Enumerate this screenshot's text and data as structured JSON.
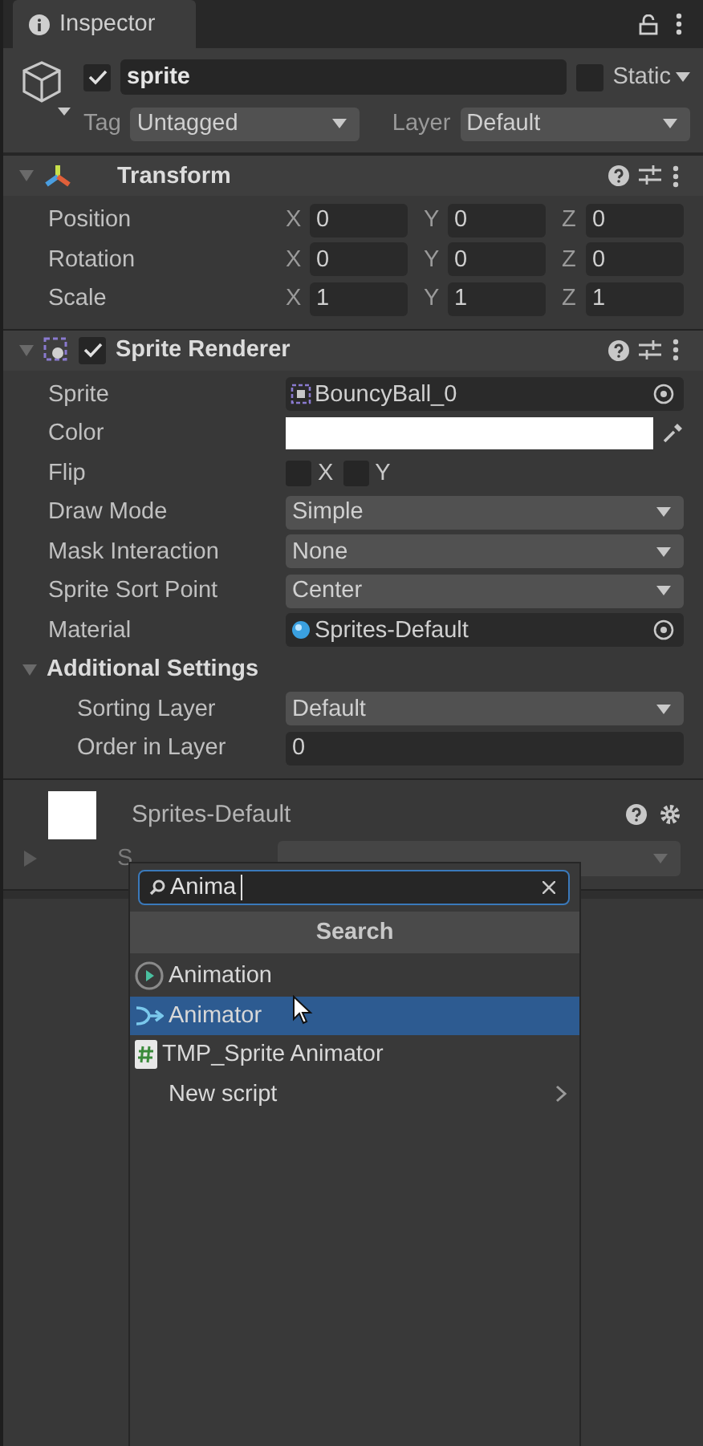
{
  "tab": {
    "label": "Inspector"
  },
  "object": {
    "active": true,
    "name": "sprite",
    "static": false,
    "static_label": "Static",
    "tag_label": "Tag",
    "tag": "Untagged",
    "layer_label": "Layer",
    "layer": "Default"
  },
  "transform": {
    "title": "Transform",
    "expanded": true,
    "rows": [
      {
        "label": "Position",
        "axes": [
          {
            "axis": "X",
            "value": "0"
          },
          {
            "axis": "Y",
            "value": "0"
          },
          {
            "axis": "Z",
            "value": "0"
          }
        ]
      },
      {
        "label": "Rotation",
        "axes": [
          {
            "axis": "X",
            "value": "0"
          },
          {
            "axis": "Y",
            "value": "0"
          },
          {
            "axis": "Z",
            "value": "0"
          }
        ]
      },
      {
        "label": "Scale",
        "axes": [
          {
            "axis": "X",
            "value": "1"
          },
          {
            "axis": "Y",
            "value": "1"
          },
          {
            "axis": "Z",
            "value": "1"
          }
        ]
      }
    ]
  },
  "sprite_renderer": {
    "title": "Sprite Renderer",
    "enabled": true,
    "expanded": true,
    "fields": [
      {
        "kind": "sprite_ref",
        "label": "Sprite",
        "value": "BouncyBall_0"
      },
      {
        "kind": "color",
        "label": "Color",
        "color": "#ffffff"
      },
      {
        "kind": "flip",
        "label": "Flip",
        "options": [
          {
            "label": "X",
            "checked": false
          },
          {
            "label": "Y",
            "checked": false
          }
        ]
      },
      {
        "kind": "dropdown",
        "label": "Draw Mode",
        "value": "Simple"
      },
      {
        "kind": "dropdown",
        "label": "Mask Interaction",
        "value": "None"
      },
      {
        "kind": "dropdown",
        "label": "Sprite Sort Point",
        "value": "Center"
      },
      {
        "kind": "material_ref",
        "label": "Material",
        "value": "Sprites-Default"
      }
    ],
    "additional": {
      "title": "Additional Settings",
      "expanded": true,
      "fields": [
        {
          "kind": "dropdown",
          "label": "Sorting Layer",
          "value": "Default"
        },
        {
          "kind": "number",
          "label": "Order in Layer",
          "value": "0"
        }
      ]
    }
  },
  "material": {
    "name": "Sprites-Default",
    "expanded": false,
    "shader_label": "S"
  },
  "popup": {
    "query": "Anima",
    "header": "Search",
    "items": [
      {
        "kind": "animation",
        "label": "Animation",
        "selected": false
      },
      {
        "kind": "animator",
        "label": "Animator",
        "selected": true
      },
      {
        "kind": "script",
        "label": "TMP_Sprite Animator",
        "selected": false
      },
      {
        "kind": "submenu",
        "label": "New script",
        "selected": false
      }
    ]
  }
}
